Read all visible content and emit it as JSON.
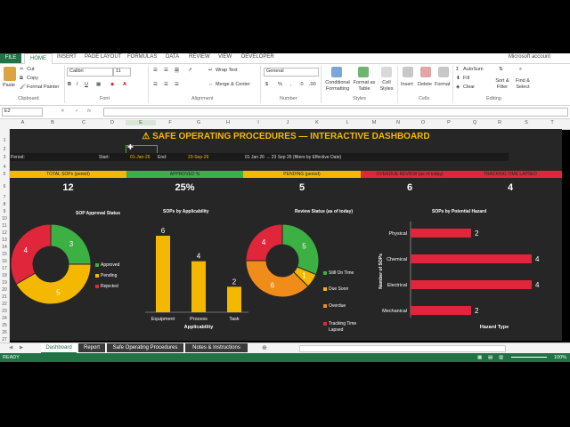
{
  "ribbon": {
    "tabs": [
      "FILE",
      "HOME",
      "INSERT",
      "PAGE LAYOUT",
      "FORMULAS",
      "DATA",
      "REVIEW",
      "VIEW",
      "DEVELOPER"
    ],
    "account": "Microsoft account",
    "clipboard": {
      "paste": "Paste",
      "cut": "Cut",
      "copy": "Copy",
      "format_painter": "Format Painter",
      "group": "Clipboard"
    },
    "font": {
      "name": "Calibri",
      "size": "11",
      "group": "Font"
    },
    "alignment": {
      "wrap": "Wrap Text",
      "merge": "Merge & Center",
      "group": "Alignment"
    },
    "number": {
      "format": "General",
      "group": "Number"
    },
    "styles": {
      "conditional": "Conditional Formatting",
      "format_table": "Format as Table",
      "cell_styles": "Cell Styles",
      "group": "Styles"
    },
    "cells": {
      "insert": "Insert",
      "delete": "Delete",
      "format": "Format",
      "group": "Cells"
    },
    "editing": {
      "autosum": "AutoSum",
      "fill": "Fill",
      "clear": "Clear",
      "sort": "Sort & Filter",
      "find": "Find & Select",
      "group": "Editing"
    }
  },
  "formula_bar": {
    "name_box": "E2",
    "formula": ""
  },
  "columns": [
    "A",
    "B",
    "C",
    "D",
    "E",
    "F",
    "G",
    "H",
    "I",
    "J",
    "K",
    "L",
    "M",
    "N",
    "O",
    "P",
    "Q",
    "R",
    "S",
    "T"
  ],
  "rows": [
    "1",
    "2",
    "3",
    "4",
    "5",
    "6",
    "7",
    "8",
    "9",
    "10",
    "11",
    "12",
    "13",
    "14",
    "15",
    "16",
    "17",
    "18",
    "19",
    "20",
    "21",
    "22",
    "23",
    "24",
    "25",
    "26",
    "27"
  ],
  "dashboard": {
    "title": "SAFE OPERATING PROCEDURES — INTERACTIVE DASHBOARD",
    "period_label": "Period:",
    "start_label": "Start:",
    "start_value": "01-Jan-26",
    "end_label": "End:",
    "end_value": "23-Sep-26",
    "range_text": "01 Jan 26 → 23 Sep 26  (filters by Effective Date)",
    "kpis": [
      {
        "label": "TOTAL SOPs (period)",
        "value": "12",
        "color": "#f5b800"
      },
      {
        "label": "APPROVED %",
        "value": "25%",
        "color": "#3cb043"
      },
      {
        "label": "PENDING (period)",
        "value": "5",
        "color": "#f5b800"
      },
      {
        "label": "OVERDUE REVIEW (as of today)",
        "value": "6",
        "color": "#e0263a"
      },
      {
        "label": "TRACKING TIME LAPSED",
        "value": "4",
        "color": "#e0263a"
      }
    ]
  },
  "chart_data": [
    {
      "type": "pie",
      "title": "SOP Approval Status",
      "categories": [
        "Approved",
        "Pending",
        "Rejected"
      ],
      "values": [
        3,
        5,
        4
      ],
      "colors": [
        "#3cb043",
        "#f5b800",
        "#e0263a"
      ]
    },
    {
      "type": "bar",
      "title": "SOPs by Applicability",
      "categories": [
        "Equipment",
        "Process",
        "Task"
      ],
      "values": [
        6,
        4,
        2
      ],
      "xlabel": "Applicability",
      "ylim": [
        0,
        6
      ],
      "color": "#f5b800"
    },
    {
      "type": "pie",
      "title": "Review Status (as of today)",
      "categories": [
        "Still On Time",
        "Due Soon",
        "Overdue",
        "Tracking Time Lapsed"
      ],
      "values": [
        5,
        1,
        6,
        4
      ],
      "colors": [
        "#3cb043",
        "#f5b800",
        "#f08c1a",
        "#e0263a"
      ]
    },
    {
      "type": "bar",
      "orientation": "horizontal",
      "title": "SOPs by Potential Hazard",
      "categories": [
        "Physical",
        "Chemical",
        "Electrical",
        "Mechanical"
      ],
      "values": [
        2,
        4,
        4,
        2
      ],
      "xlabel": "Hazard Type",
      "ylabel": "Number of SOPs",
      "xlim": [
        0,
        4
      ],
      "color": "#e0263a"
    }
  ],
  "sheets": [
    "Dashboard",
    "Report",
    "Safe Operating Procedures",
    "Notes & Instructions"
  ],
  "status": {
    "ready": "READY",
    "zoom": "100%"
  }
}
